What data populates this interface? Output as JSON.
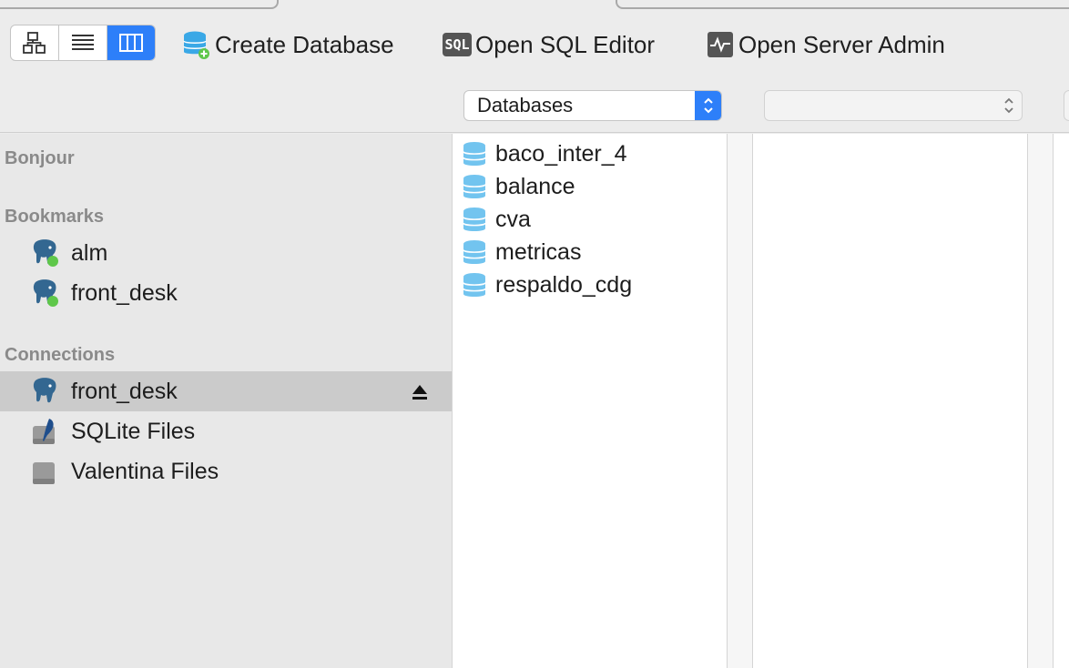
{
  "toolbar": {
    "view_modes": [
      {
        "name": "hierarchy-view",
        "icon": "hierarchy-icon",
        "active": false
      },
      {
        "name": "list-view",
        "icon": "list-icon",
        "active": false
      },
      {
        "name": "column-view",
        "icon": "columns-icon",
        "active": true
      }
    ],
    "create_database": "Create Database",
    "open_sql_editor": "Open SQL Editor",
    "sql_icon_text": "SQL",
    "open_server_admin": "Open Server Admin",
    "accent_color": "#2d7ff9"
  },
  "filters": {
    "database_select": "Databases",
    "second_select": ""
  },
  "sidebar": {
    "bonjour_header": "Bonjour",
    "bookmarks_header": "Bookmarks",
    "bookmarks": [
      {
        "label": "alm",
        "icon": "postgres-elephant-icon"
      },
      {
        "label": "front_desk",
        "icon": "postgres-elephant-icon"
      }
    ],
    "connections_header": "Connections",
    "connections": [
      {
        "label": "front_desk",
        "icon": "postgres-elephant-icon",
        "selected": true
      },
      {
        "label": "SQLite Files",
        "icon": "sqlite-feather-icon",
        "selected": false
      },
      {
        "label": "Valentina Files",
        "icon": "drive-icon",
        "selected": false
      }
    ]
  },
  "databases": [
    {
      "label": "baco_inter_4"
    },
    {
      "label": "balance"
    },
    {
      "label": "cva"
    },
    {
      "label": "metricas"
    },
    {
      "label": "respaldo_cdg"
    }
  ]
}
